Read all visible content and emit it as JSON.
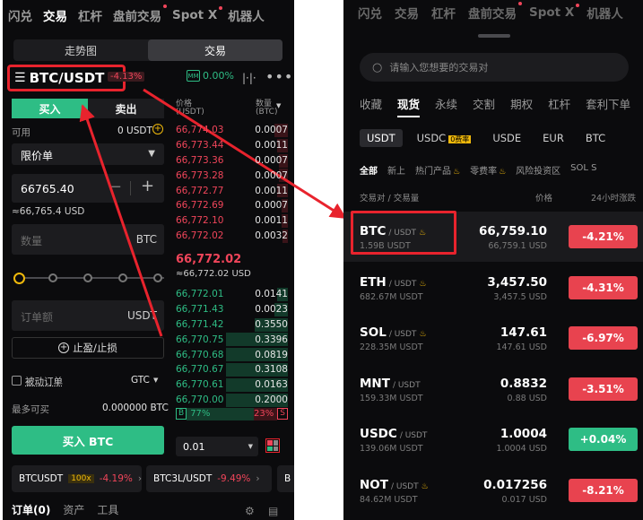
{
  "left": {
    "nav": [
      {
        "label": "闪兑",
        "active": false,
        "dot": false
      },
      {
        "label": "交易",
        "active": true,
        "dot": false
      },
      {
        "label": "杠杆",
        "active": false,
        "dot": false
      },
      {
        "label": "盘前交易",
        "active": false,
        "dot": true
      },
      {
        "label": "Spot X",
        "active": false,
        "dot": true
      },
      {
        "label": "机器人",
        "active": false,
        "dot": false
      }
    ],
    "seg": {
      "chart": "走势图",
      "trade": "交易"
    },
    "pair": "BTC/USDT",
    "pair_change": "-4.13%",
    "mm_label": "MM",
    "mm_value": "0.00%",
    "buy_tab": "买入",
    "sell_tab": "卖出",
    "available_label": "可用",
    "available_value": "0 USDT",
    "order_type": "限价单",
    "price_input": "66765.40",
    "price_approx": "≈66,765.4 USD",
    "qty_placeholder": "数量",
    "qty_unit": "BTC",
    "amount_placeholder": "订单额",
    "amount_unit": "USDT",
    "tpsl": "止盈/止损",
    "passive": "被动订单",
    "tif": "GTC",
    "maxbuy_label": "最多可买",
    "maxbuy_value": "0.000000 BTC",
    "buy_button": "买入 BTC",
    "ob_header": {
      "price": "价格",
      "price_unit": "(USDT)",
      "qty": "数量",
      "qty_unit": "(BTC)"
    },
    "asks": [
      {
        "price": "66,774.03",
        "qty": "0.0007",
        "depth": 0.12
      },
      {
        "price": "66,773.44",
        "qty": "0.0011",
        "depth": 0.1
      },
      {
        "price": "66,773.36",
        "qty": "0.0007",
        "depth": 0.08
      },
      {
        "price": "66,773.28",
        "qty": "0.0007",
        "depth": 0.08
      },
      {
        "price": "66,772.77",
        "qty": "0.0011",
        "depth": 0.1
      },
      {
        "price": "66,772.69",
        "qty": "0.0007",
        "depth": 0.06
      },
      {
        "price": "66,772.10",
        "qty": "0.0011",
        "depth": 0.06
      },
      {
        "price": "66,772.02",
        "qty": "0.0032",
        "depth": 0.05
      }
    ],
    "last_price": "66,772.02",
    "last_price_usd": "≈66,772.02 USD",
    "bids": [
      {
        "price": "66,772.01",
        "qty": "0.0141",
        "depth": 0.1
      },
      {
        "price": "66,771.43",
        "qty": "0.0023",
        "depth": 0.12
      },
      {
        "price": "66,771.42",
        "qty": "0.3550",
        "depth": 0.3
      },
      {
        "price": "66,770.75",
        "qty": "0.3396",
        "depth": 0.55
      },
      {
        "price": "66,770.68",
        "qty": "0.0819",
        "depth": 0.55
      },
      {
        "price": "66,770.67",
        "qty": "0.3108",
        "depth": 0.55
      },
      {
        "price": "66,770.61",
        "qty": "0.0163",
        "depth": 0.55
      },
      {
        "price": "66,770.00",
        "qty": "0.2000",
        "depth": 0.55
      }
    ],
    "ratio": {
      "b_label": "B",
      "b_pct": "77%",
      "s_pct": "23%",
      "s_label": "S",
      "b_share": 0.77
    },
    "tick": "0.01",
    "chips": [
      {
        "name": "BTCUSDT",
        "lev": "100x",
        "chg": "-4.19%"
      },
      {
        "name": "BTC3L/USDT",
        "lev": "",
        "chg": "-9.49%"
      },
      {
        "name": "B",
        "lev": "",
        "chg": ""
      }
    ],
    "bottom_tabs": [
      "订单(0)",
      "资产",
      "工具"
    ]
  },
  "right": {
    "nav": [
      {
        "label": "闪兑",
        "dot": false,
        "active": false
      },
      {
        "label": "交易",
        "dot": false,
        "active": false
      },
      {
        "label": "杠杆",
        "dot": false,
        "active": false
      },
      {
        "label": "盘前交易",
        "dot": true,
        "active": false
      },
      {
        "label": "Spot X",
        "dot": true,
        "active": false
      },
      {
        "label": "机器人",
        "dot": false,
        "active": false
      }
    ],
    "search_placeholder": "请输入您想要的交易对",
    "tabs1": [
      "收藏",
      "现货",
      "永续",
      "交割",
      "期权",
      "杠杆",
      "套利下单"
    ],
    "tabs1_active": 1,
    "tabs2": [
      "USDT",
      "USDC",
      "USDE",
      "EUR",
      "BTC"
    ],
    "usdc_badge": "0费率",
    "tabs3": [
      "全部",
      "新上",
      "热门产品",
      "零费率",
      "风险投资区",
      "SOL S"
    ],
    "col_pair": "交易对 / 交易量",
    "col_price": "价格",
    "col_change": "24小时涨跌",
    "markets": [
      {
        "sym": "BTC",
        "quote": "/ USDT",
        "fire": true,
        "vol": "1.59B USDT",
        "price": "66,759.10",
        "sub": "66,759.1 USD",
        "chg": "-4.21%",
        "up": false
      },
      {
        "sym": "ETH",
        "quote": "/ USDT",
        "fire": true,
        "vol": "682.67M USDT",
        "price": "3,457.50",
        "sub": "3,457.5 USD",
        "chg": "-4.31%",
        "up": false
      },
      {
        "sym": "SOL",
        "quote": "/ USDT",
        "fire": true,
        "vol": "228.35M USDT",
        "price": "147.61",
        "sub": "147.61 USD",
        "chg": "-6.97%",
        "up": false
      },
      {
        "sym": "MNT",
        "quote": "/ USDT",
        "fire": false,
        "vol": "159.33M USDT",
        "price": "0.8832",
        "sub": "0.88 USD",
        "chg": "-3.51%",
        "up": false
      },
      {
        "sym": "USDC",
        "quote": "/ USDT",
        "fire": false,
        "vol": "139.06M USDT",
        "price": "1.0004",
        "sub": "1.0004 USD",
        "chg": "+0.04%",
        "up": true
      },
      {
        "sym": "NOT",
        "quote": "/ USDT",
        "fire": true,
        "vol": "84.62M USDT",
        "price": "0.017256",
        "sub": "0.017 USD",
        "chg": "-8.21%",
        "up": false
      }
    ]
  },
  "colors": {
    "up": "#2ebd85",
    "down": "#f0455a",
    "down_btn": "#e8434f",
    "highlight": "#e8232d",
    "bg": "#0b0b0d"
  }
}
